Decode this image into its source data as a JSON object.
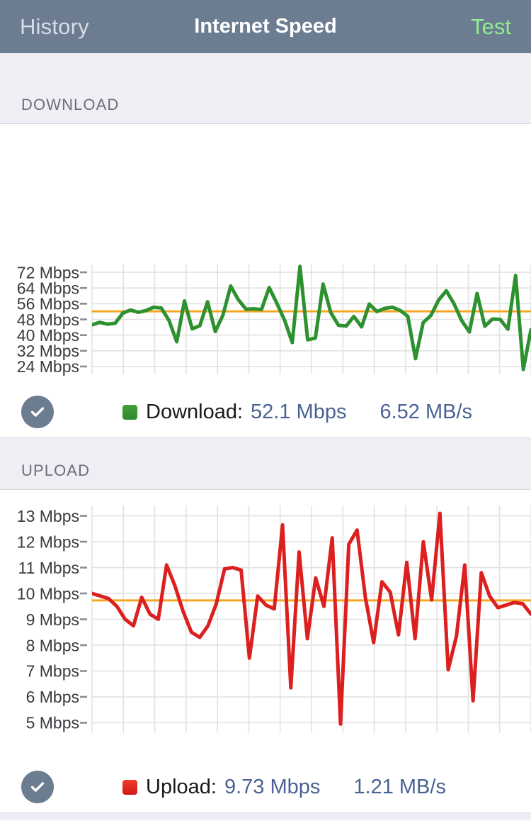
{
  "navbar": {
    "back_label": "History",
    "title": "Internet Speed",
    "action_label": "Test",
    "bg_color": "#6c7d91",
    "back_color": "#d7dee8",
    "action_color": "#90ee90"
  },
  "sections": {
    "download": {
      "header": "DOWNLOAD"
    },
    "upload": {
      "header": "UPLOAD"
    }
  },
  "legend": {
    "download": {
      "icon": "check-circle-icon",
      "swatch_color": "#3a9a33",
      "name": "Download:",
      "mbps": "52.1 Mbps",
      "mbs": "6.52 MB/s"
    },
    "upload": {
      "icon": "check-circle-icon",
      "swatch_color": "#e02a1c",
      "name": "Upload:",
      "mbps": "9.73 Mbps",
      "mbs": "1.21 MB/s"
    }
  },
  "chart_data": [
    {
      "id": "download-chart",
      "type": "line",
      "title": "DOWNLOAD",
      "xlabel": "",
      "ylabel": "Mbps",
      "series_name": "Download",
      "line_color": "#2e9130",
      "average_line_color": "#f5a623",
      "average_value": 52.1,
      "grid": true,
      "ylim": [
        20,
        76
      ],
      "yticks": [
        24,
        32,
        40,
        48,
        56,
        64,
        72
      ],
      "ytick_labels": [
        "24 Mbps",
        "32 Mbps",
        "40 Mbps",
        "48 Mbps",
        "56 Mbps",
        "64 Mbps",
        "72 Mbps"
      ],
      "x": [
        0,
        1,
        2,
        3,
        4,
        5,
        6,
        7,
        8,
        9,
        10,
        11,
        12,
        13,
        14,
        15,
        16,
        17,
        18,
        19,
        20,
        21,
        22,
        23,
        24,
        25,
        26,
        27,
        28,
        29,
        30,
        31,
        32,
        33,
        34,
        35,
        36,
        37,
        38,
        39,
        40,
        41,
        42,
        43,
        44,
        45,
        46,
        47,
        48,
        49,
        50,
        51,
        52,
        53,
        54,
        55,
        56,
        57,
        58,
        59,
        60,
        61,
        62,
        63,
        64,
        65,
        66,
        67,
        68,
        69
      ],
      "values": [
        45.2,
        46.5,
        45.6,
        46.0,
        51.2,
        52.8,
        51.6,
        52.5,
        54.2,
        53.8,
        47.4,
        36.6,
        57.4,
        43.2,
        44.8,
        57.0,
        41.8,
        50.2,
        65.0,
        58.0,
        53.2,
        53.4,
        53.0,
        64.2,
        56.2,
        47.6,
        36.2,
        75.0,
        37.6,
        38.5,
        66.0,
        51.5,
        45.0,
        44.6,
        49.5,
        44.2,
        55.8,
        52.0,
        53.6,
        54.2,
        52.6,
        49.6,
        28.0,
        46.4,
        50.0,
        57.8,
        62.6,
        56.0,
        47.4,
        41.6,
        61.2,
        44.5,
        48.2,
        48.0,
        43.0,
        70.4,
        22.5,
        42.8
      ],
      "gridline_count_x": 14
    },
    {
      "id": "upload-chart",
      "type": "line",
      "title": "UPLOAD",
      "xlabel": "",
      "ylabel": "Mbps",
      "series_name": "Upload",
      "line_color": "#dc1f1f",
      "average_line_color": "#f5a623",
      "average_value": 9.73,
      "grid": true,
      "ylim": [
        4.6,
        13.4
      ],
      "yticks": [
        5,
        6,
        7,
        8,
        9,
        10,
        11,
        12,
        13
      ],
      "ytick_labels": [
        "5 Mbps",
        "6 Mbps",
        "7 Mbps",
        "8 Mbps",
        "9 Mbps",
        "10 Mbps",
        "11 Mbps",
        "12 Mbps",
        "13 Mbps"
      ],
      "x": [
        0,
        1,
        2,
        3,
        4,
        5,
        6,
        7,
        8,
        9,
        10,
        11,
        12,
        13,
        14,
        15,
        16,
        17,
        18,
        19,
        20,
        21,
        22,
        23,
        24,
        25,
        26,
        27,
        28,
        29,
        30,
        31,
        32,
        33,
        34,
        35,
        36,
        37,
        38,
        39,
        40,
        41,
        42,
        43,
        44,
        45,
        46,
        47,
        48,
        49,
        50,
        51,
        52,
        53,
        54,
        55,
        56,
        57
      ],
      "values": [
        10.0,
        9.9,
        9.8,
        9.5,
        9.0,
        8.75,
        9.85,
        9.2,
        9.0,
        11.1,
        10.3,
        9.3,
        8.5,
        8.3,
        8.75,
        9.6,
        10.95,
        11.0,
        10.9,
        7.5,
        9.9,
        9.55,
        9.4,
        12.65,
        6.35,
        11.6,
        8.25,
        10.6,
        9.5,
        12.15,
        4.95,
        11.9,
        12.45,
        9.85,
        8.1,
        10.45,
        10.05,
        8.4,
        11.2,
        8.25,
        12.0,
        9.75,
        13.1,
        7.05,
        8.35,
        11.1,
        5.85,
        10.8,
        9.9,
        9.45,
        9.55,
        9.65,
        9.6,
        9.2
      ],
      "gridline_count_x": 14
    }
  ]
}
